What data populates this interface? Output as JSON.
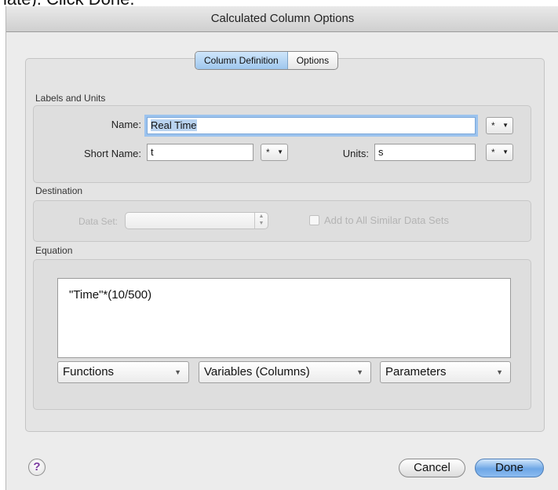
{
  "background_text": "late). Click Done.",
  "window": {
    "title": "Calculated Column Options"
  },
  "tabs": [
    {
      "label": "Column Definition",
      "active": true
    },
    {
      "label": "Options",
      "active": false
    }
  ],
  "labels_units": {
    "section_label": "Labels and Units",
    "name_label": "Name:",
    "name_value": "Real Time",
    "short_name_label": "Short Name:",
    "short_name_value": "t",
    "units_label": "Units:",
    "units_value": "s",
    "popup_symbol": "*",
    "popup_arrow": "▼"
  },
  "destination": {
    "section_label": "Destination",
    "data_set_label": "Data Set:",
    "data_set_value": "",
    "add_all_label": "Add to All Similar Data Sets"
  },
  "equation": {
    "section_label": "Equation",
    "value": "\"Time\"*(10/500)",
    "functions_label": "Functions",
    "variables_label": "Variables (Columns)",
    "parameters_label": "Parameters",
    "dropdown_arrow": "▼"
  },
  "footer": {
    "help_symbol": "?",
    "cancel_label": "Cancel",
    "done_label": "Done"
  },
  "colors": {
    "accent": "#6ea7e6",
    "focus_ring": "#9cc3ee",
    "help_icon": "#7b3aa0"
  }
}
